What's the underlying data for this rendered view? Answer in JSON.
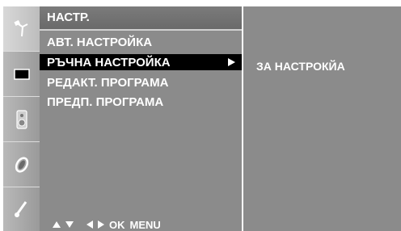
{
  "menu": {
    "title": "НАСТР.",
    "items": [
      {
        "label": "АВТ. НАСТРОЙКА",
        "selected": false
      },
      {
        "label": "РЪЧНА НАСТРОЙКА",
        "selected": true
      },
      {
        "label": "РЕДАКТ. ПРОГРАМА",
        "selected": false
      },
      {
        "label": "ПРЕДП. ПРОГРАМА",
        "selected": false
      }
    ],
    "hint": {
      "ok": "OK",
      "menu": "MENU"
    }
  },
  "submenu": {
    "label": "ЗА НАСТРОКЙА"
  },
  "rail": {
    "icons": [
      "antenna-icon",
      "picture-icon",
      "speaker-icon",
      "time-icon",
      "settings-icon"
    ],
    "active_index": 0
  },
  "colors": {
    "panel": "#8b8b8b",
    "selected": "#000000",
    "text": "#ffffff"
  }
}
